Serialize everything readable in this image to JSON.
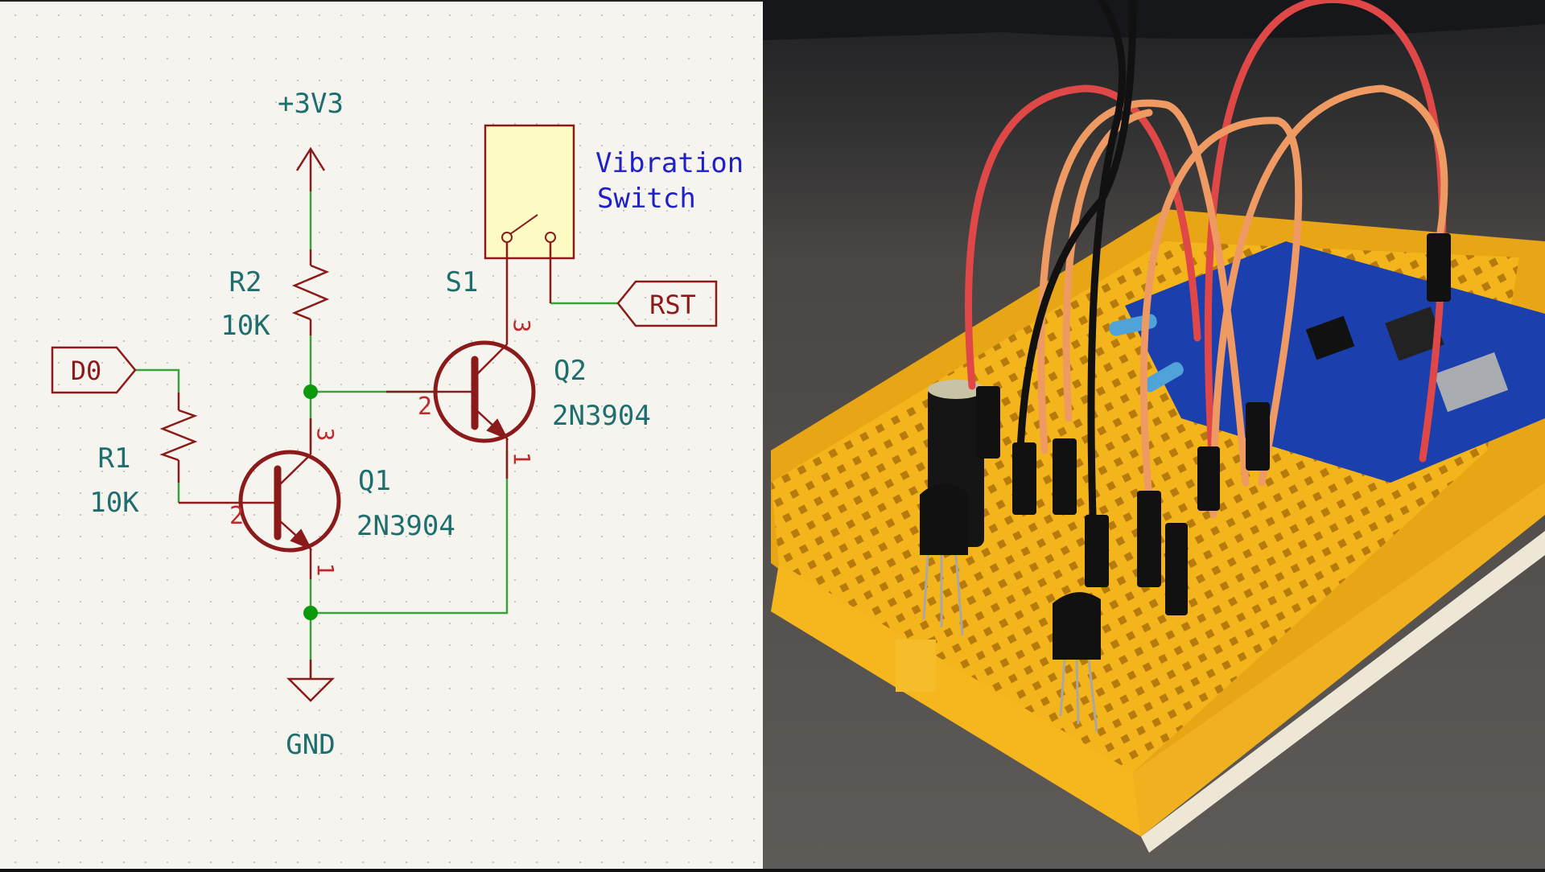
{
  "schematic": {
    "power_label": "+3V3",
    "ground_label": "GND",
    "components": {
      "R1": {
        "ref": "R1",
        "value": "10K"
      },
      "R2": {
        "ref": "R2",
        "value": "10K"
      },
      "Q1": {
        "ref": "Q1",
        "value": "2N3904",
        "pins": {
          "base": "2",
          "collector": "3",
          "emitter": "1"
        }
      },
      "Q2": {
        "ref": "Q2",
        "value": "2N3904",
        "pins": {
          "base": "2",
          "collector": "3",
          "emitter": "1"
        }
      },
      "S1": {
        "ref": "S1"
      }
    },
    "net_labels": {
      "input": "D0",
      "output": "RST"
    },
    "annotation": {
      "line1": "Vibration",
      "line2": "Switch"
    },
    "colors": {
      "background": "#f5f4ef",
      "symbol": "#8b1a1a",
      "wire": "#3aa23a",
      "junction": "#0a9a0a",
      "ref_text": "#1f6e6e",
      "note_text": "#2020c8",
      "switch_fill": "#fdfbc4"
    }
  },
  "photo": {
    "description": "Breadboard prototype with two transistors, capacitor, resistors, jumper wires and a blue microcontroller board",
    "colors": {
      "table": "#5a5653",
      "breadboard": "#f2b21b",
      "board": "#1c3fae",
      "wire_red": "#e04848",
      "wire_orange": "#ee9a62",
      "wire_black": "#111111"
    }
  }
}
